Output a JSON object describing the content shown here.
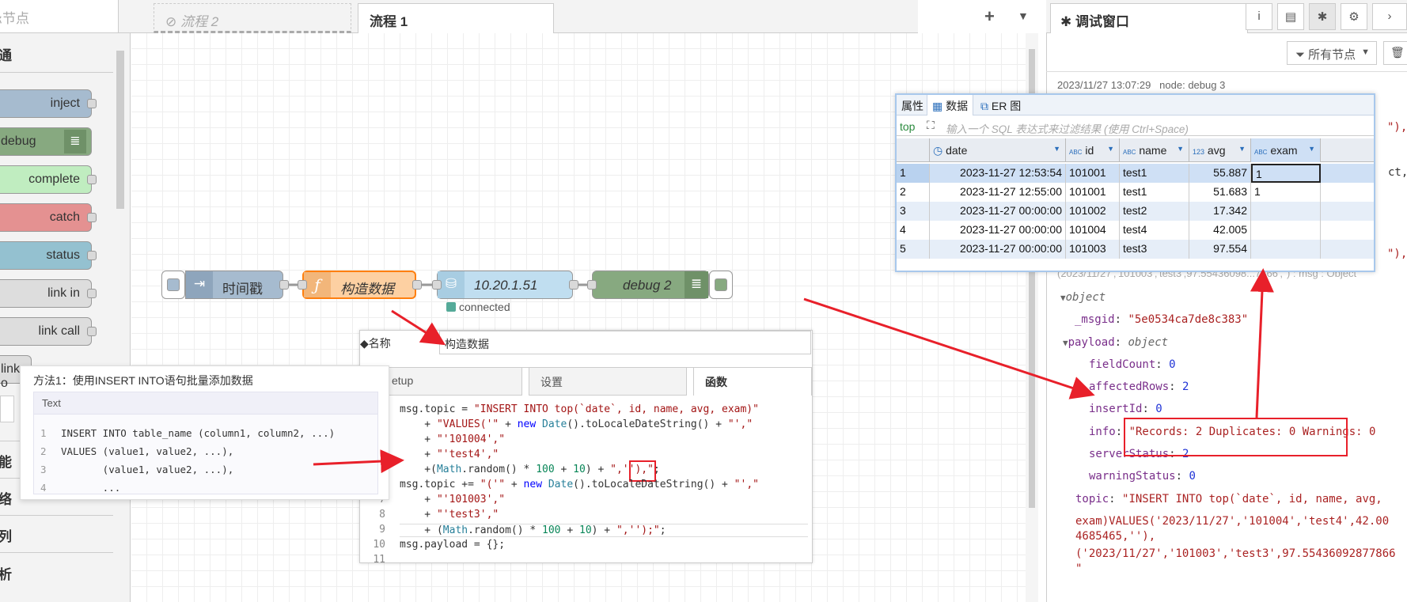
{
  "palette": {
    "header": "忌节点",
    "categories": [
      "通",
      "能",
      "络",
      "列",
      "析"
    ],
    "nodes": [
      "inject",
      "debug",
      "complete",
      "catch",
      "status",
      "link in",
      "link call",
      "link o"
    ]
  },
  "tabs": {
    "flow2": "流程 2",
    "flow1": "流程 1"
  },
  "flow": {
    "nodes": [
      {
        "label": "时间戳",
        "color": "#a6bbcf"
      },
      {
        "label": "构造数据",
        "color": "#fdd0a2"
      },
      {
        "label": "10.20.1.51",
        "color": "#c0def0"
      },
      {
        "label": "debug 2",
        "color": "#87a980"
      }
    ],
    "status": "connected"
  },
  "sidebar": {
    "title": "调试窗口",
    "filter": "所有节点",
    "messages": {
      "timestamp": "2023/11/27 13:07:29",
      "node": "node: debug 3",
      "fragments": [
        "\"),",
        "ct,",
        "\"),"
      ],
      "partial_line": "(2023/11/27','101003','test3',97.55436098...7866','') : msg : Object",
      "object_label": "object",
      "msgid_key": "_msgid",
      "msgid_val": "\"5e0534ca7de8c383\"",
      "payload_key": "payload",
      "payload_type": "object",
      "fields": [
        {
          "k": "fieldCount",
          "v": "0"
        },
        {
          "k": "affectedRows",
          "v": "2"
        },
        {
          "k": "insertId",
          "v": "0"
        },
        {
          "k": "info",
          "v": "\"Records: 2  Duplicates: 0  Warnings: 0"
        },
        {
          "k": "serverStatus",
          "v": "2"
        },
        {
          "k": "warningStatus",
          "v": "0"
        }
      ],
      "topic_key": "topic",
      "topic_lines": [
        "\"INSERT INTO top(`date`, id, name, avg,",
        "exam)VALUES('2023/11/27','101004','test4',42.00",
        "4685465,''),",
        "('2023/11/27','101003','test3',97.55436092877866",
        "\""
      ]
    }
  },
  "db": {
    "tabs": [
      "属性",
      "数据",
      "ER 图"
    ],
    "table_prefix": "top",
    "filter_placeholder": "输入一个 SQL 表达式来过滤结果 (使用 Ctrl+Space)",
    "columns": [
      "date",
      "id",
      "name",
      "avg",
      "exam"
    ],
    "column_types": [
      "",
      "ABC",
      "ABC",
      "123",
      "ABC"
    ],
    "rows": [
      {
        "n": "1",
        "date": "2023-11-27 12:53:54",
        "id": "101001",
        "name": "test1",
        "avg": "55.887",
        "exam": "1"
      },
      {
        "n": "2",
        "date": "2023-11-27 12:55:00",
        "id": "101001",
        "name": "test1",
        "avg": "51.683",
        "exam": "1"
      },
      {
        "n": "3",
        "date": "2023-11-27 00:00:00",
        "id": "101002",
        "name": "test2",
        "avg": "17.342",
        "exam": ""
      },
      {
        "n": "4",
        "date": "2023-11-27 00:00:00",
        "id": "101004",
        "name": "test4",
        "avg": "42.005",
        "exam": ""
      },
      {
        "n": "5",
        "date": "2023-11-27 00:00:00",
        "id": "101003",
        "name": "test3",
        "avg": "97.554",
        "exam": ""
      }
    ]
  },
  "dialog": {
    "name_label": "名称",
    "name_value": "构造数据",
    "tabs": [
      "etup",
      "设置",
      "函数"
    ],
    "line_numbers": [
      "",
      "",
      "",
      "",
      "",
      "",
      "7",
      "8",
      "9",
      "10",
      "11"
    ]
  },
  "snippet": {
    "title": "方法1：使用INSERT INTO语句批量添加数据",
    "lang": "Text",
    "lines": [
      {
        "n": "1",
        "t": "INSERT INTO table_name (column1, column2, ...)"
      },
      {
        "n": "2",
        "t": "VALUES (value1, value2, ...),"
      },
      {
        "n": "3",
        "t": "       (value1, value2, ...),"
      },
      {
        "n": "4",
        "t": "       ..."
      }
    ]
  },
  "colors": {
    "accent": "#ff0000",
    "arrow": "#e8202a"
  }
}
